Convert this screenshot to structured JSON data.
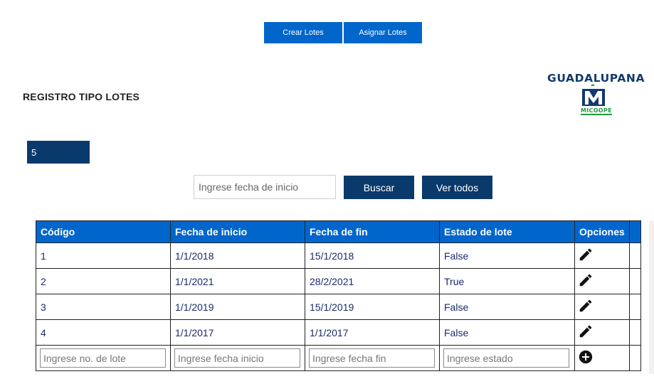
{
  "nav": {
    "crear_label": "Crear Lotes",
    "asignar_label": "Asignar Lotes"
  },
  "page": {
    "title": "REGISTRO TIPO LOTES"
  },
  "logo": {
    "name": "GUADALUPANA",
    "sub": "MICOOPE",
    "icon": "micoope-logo"
  },
  "counter": {
    "value": "5"
  },
  "search": {
    "placeholder": "Ingrese fecha de inicio",
    "buscar_label": "Buscar",
    "ver_todos_label": "Ver todos"
  },
  "table": {
    "headers": [
      "Código",
      "Fecha de inicio",
      "Fecha de fin",
      "Estado de lote",
      "Opciones"
    ],
    "rows": [
      {
        "codigo": "1",
        "inicio": "1/1/2018",
        "fin": "15/1/2018",
        "estado": "False",
        "icon": "edit-pencil-icon"
      },
      {
        "codigo": "2",
        "inicio": "1/1/2021",
        "fin": "28/2/2021",
        "estado": "True",
        "icon": "edit-pencil-icon"
      },
      {
        "codigo": "3",
        "inicio": "1/1/2019",
        "fin": "15/1/2019",
        "estado": "False",
        "icon": "edit-pencil-icon"
      },
      {
        "codigo": "4",
        "inicio": "1/1/2017",
        "fin": "1/1/2017",
        "estado": "False",
        "icon": "edit-pencil-icon"
      }
    ],
    "new_row": {
      "codigo_placeholder": "Ingrese no. de lote",
      "inicio_placeholder": "Ingrese fecha inicio",
      "fin_placeholder": "Ingrese fecha fin",
      "estado_placeholder": "Ingrese estado",
      "add_icon": "add-circle-icon"
    }
  },
  "colors": {
    "primary": "#0066cc",
    "dark": "#0a3a6b",
    "logo_blue": "#123a6e",
    "logo_green": "#1e9b3c"
  }
}
